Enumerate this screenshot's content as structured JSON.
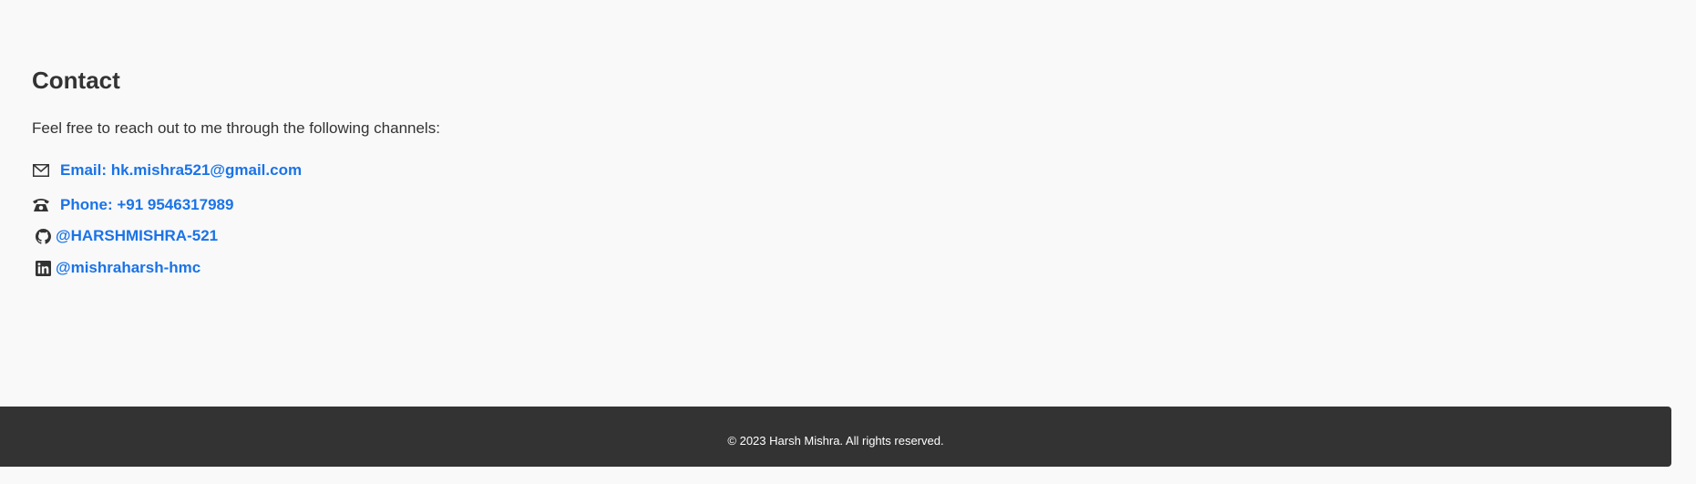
{
  "contact": {
    "heading": "Contact",
    "intro": "Feel free to reach out to me through the following channels:",
    "links": [
      {
        "icon": "envelope-icon",
        "label": "Email: hk.mishra521@gmail.com"
      },
      {
        "icon": "telephone-icon",
        "label": "Phone: +91 9546317989"
      },
      {
        "icon": "github-icon",
        "label": "@HARSHMISHRA-521"
      },
      {
        "icon": "linkedin-icon",
        "label": "@mishraharsh-hmc"
      }
    ]
  },
  "footer": {
    "copyright": "© 2023 Harsh Mishra. All rights reserved."
  },
  "colors": {
    "background": "#f9f9f9",
    "text": "#333333",
    "link": "#1a73e8",
    "footer_bg": "#333333",
    "footer_text": "#ffffff"
  }
}
